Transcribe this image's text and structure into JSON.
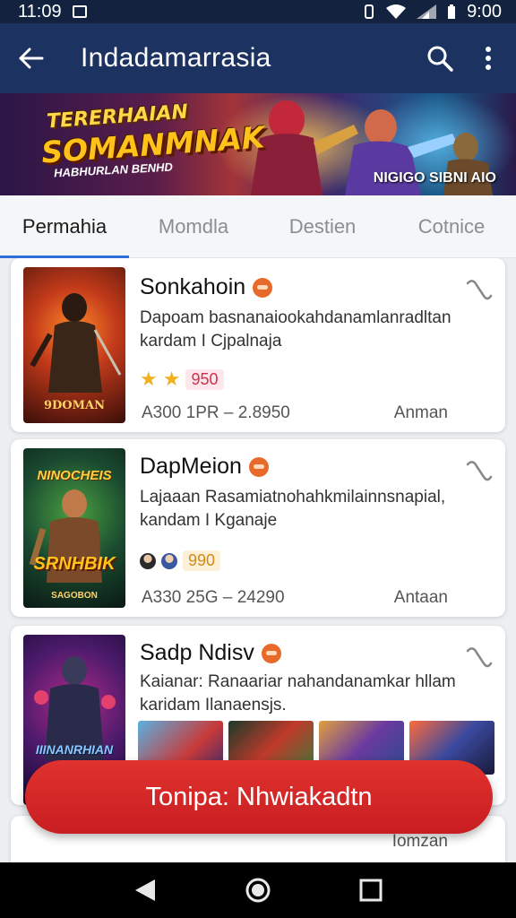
{
  "status_bar": {
    "time_left": "11:09",
    "time_right": "9:00"
  },
  "app_bar": {
    "title": "Indadamarrasia"
  },
  "banner": {
    "line1": "TERERHAIAN",
    "line2": "SOMANMNAK",
    "line3": "HABHURLAN BENHD",
    "caption": "NIGIGO SIBNI AIO"
  },
  "tabs": [
    {
      "label": "Permahia",
      "active": true
    },
    {
      "label": "Momdla",
      "active": false
    },
    {
      "label": "Destien",
      "active": false
    },
    {
      "label": "Cotnice",
      "active": false
    }
  ],
  "cards": [
    {
      "title": "Sonkahoin",
      "desc_line1": "Dapoam basnanaiookahdanamlanradltan",
      "desc_line2": "kardam I Cjpalnaja",
      "thumb_label": "9DOMAN",
      "badge_value": "950",
      "stats": "A300  1PR  –  2.8950",
      "status": "Anman"
    },
    {
      "title": "DapMeion",
      "desc_line1": "Lajaaan Rasamiatnohahkmilainnsnapial,",
      "desc_line2": "kandam I Kganaje",
      "thumb_label_top": "NINOCHEIS",
      "thumb_label_mid": "SRNHBIK",
      "thumb_label_bottom": "SAGOBON",
      "badge_value": "990",
      "stats": "A330  25G  –  24290",
      "status": "Antaan"
    },
    {
      "title": "Sadp Ndisv",
      "desc_line1": "Kaianar: Ranaariar nahandanamkar hllam",
      "desc_line2": "karidam Ilanaensjs.",
      "thumb_label": "IIINANRHIAN"
    },
    {
      "status": "Iomzan"
    }
  ],
  "fab": {
    "label": "Tonipa: Nhwiakadtn"
  },
  "colors": {
    "app_bar": "#1c3362",
    "accent": "#2f6fd6",
    "fab": "#d42a27"
  }
}
